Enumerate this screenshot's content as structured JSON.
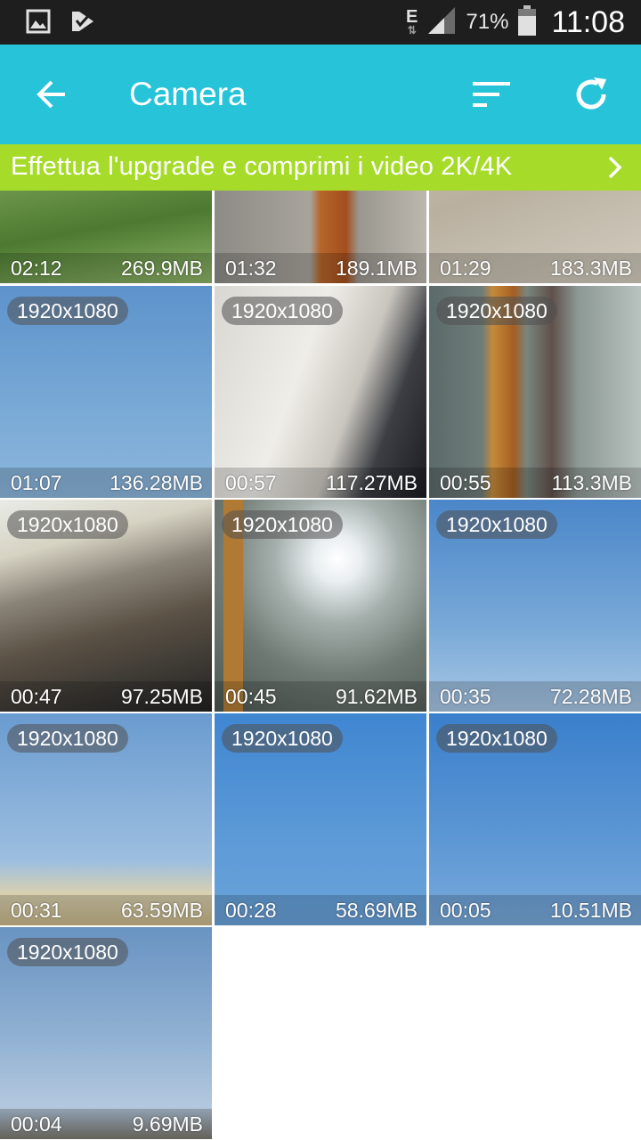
{
  "status_bar": {
    "network_type": "E",
    "battery_percent": "71%",
    "time": "11:08"
  },
  "app_bar": {
    "title": "Camera"
  },
  "banner": {
    "text": "Effettua l'upgrade e comprimi i video 2K/4K"
  },
  "videos": [
    {
      "duration": "02:12",
      "size": "269.9MB",
      "resolution": ""
    },
    {
      "duration": "01:32",
      "size": "189.1MB",
      "resolution": ""
    },
    {
      "duration": "01:29",
      "size": "183.3MB",
      "resolution": ""
    },
    {
      "duration": "01:07",
      "size": "136.28MB",
      "resolution": "1920x1080"
    },
    {
      "duration": "00:57",
      "size": "117.27MB",
      "resolution": "1920x1080"
    },
    {
      "duration": "00:55",
      "size": "113.3MB",
      "resolution": "1920x1080"
    },
    {
      "duration": "00:47",
      "size": "97.25MB",
      "resolution": "1920x1080"
    },
    {
      "duration": "00:45",
      "size": "91.62MB",
      "resolution": "1920x1080"
    },
    {
      "duration": "00:35",
      "size": "72.28MB",
      "resolution": "1920x1080"
    },
    {
      "duration": "00:31",
      "size": "63.59MB",
      "resolution": "1920x1080"
    },
    {
      "duration": "00:28",
      "size": "58.69MB",
      "resolution": "1920x1080"
    },
    {
      "duration": "00:05",
      "size": "10.51MB",
      "resolution": "1920x1080"
    },
    {
      "duration": "00:04",
      "size": "9.69MB",
      "resolution": "1920x1080"
    }
  ],
  "colors": {
    "app_bar": "#26c3d9",
    "banner": "#a6db2a",
    "status_bar": "#1e1e1e"
  }
}
